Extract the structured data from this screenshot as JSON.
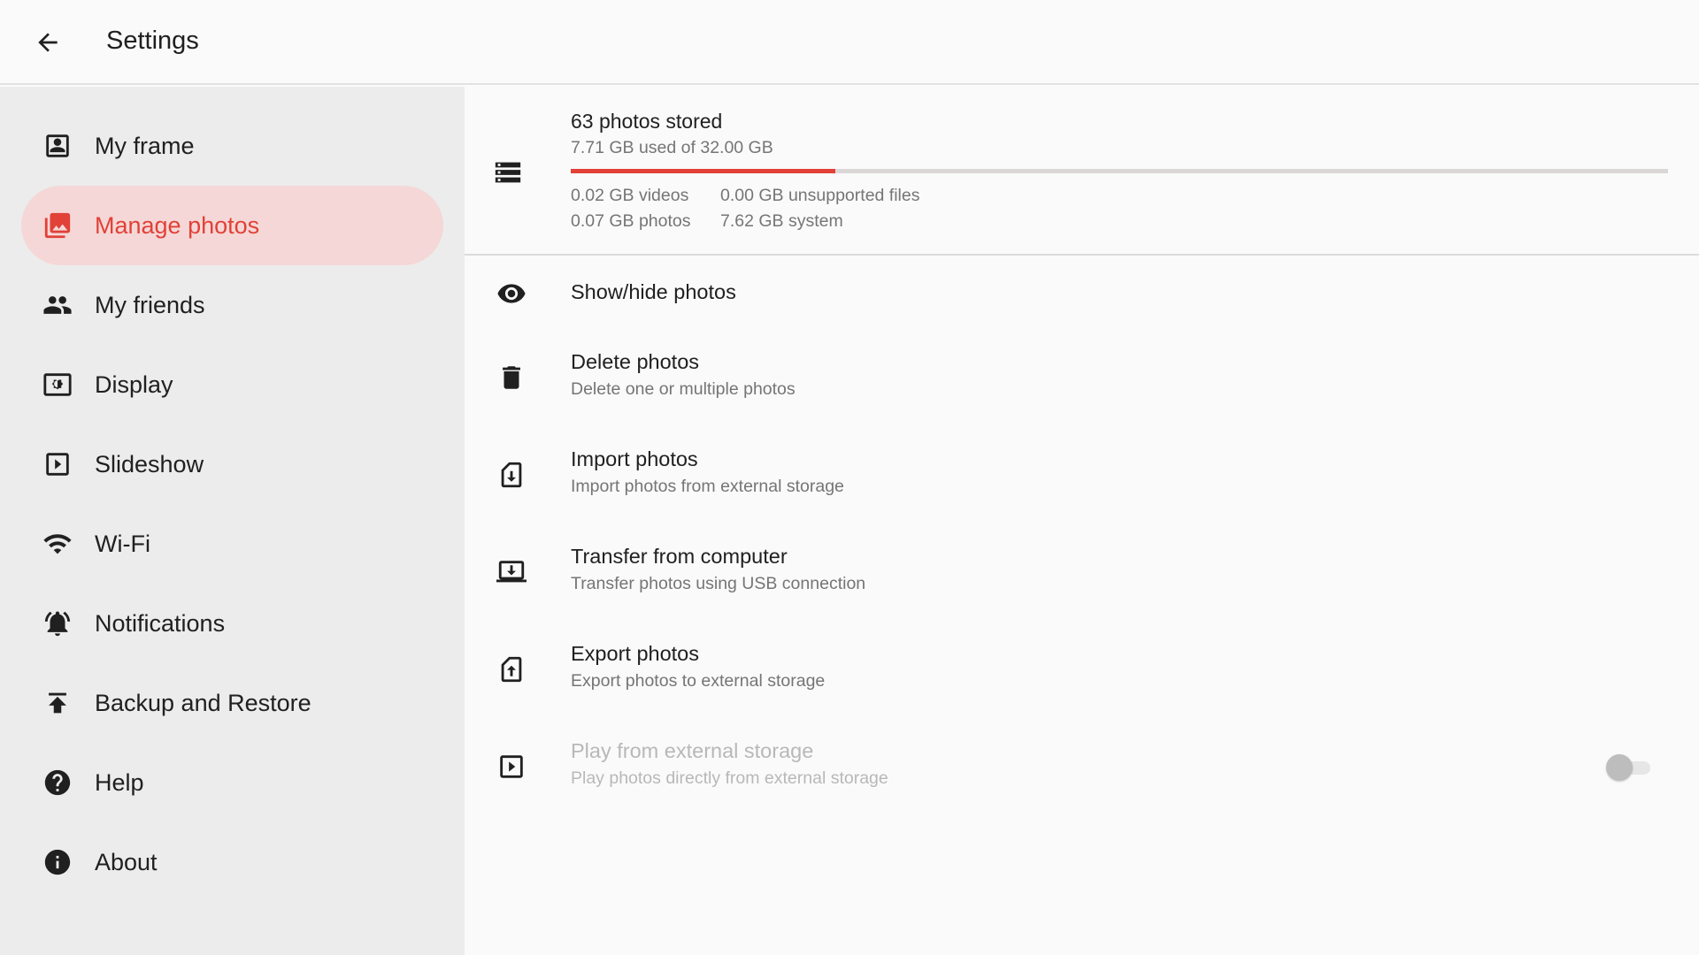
{
  "header": {
    "title": "Settings",
    "back_icon": "arrow-back-icon"
  },
  "sidebar": {
    "items": [
      {
        "label": "My frame",
        "icon": "frame-portrait-icon",
        "active": false
      },
      {
        "label": "Manage photos",
        "icon": "photo-library-icon",
        "active": true
      },
      {
        "label": "My friends",
        "icon": "people-icon",
        "active": false
      },
      {
        "label": "Display",
        "icon": "brightness-icon",
        "active": false
      },
      {
        "label": "Slideshow",
        "icon": "slideshow-icon",
        "active": false
      },
      {
        "label": "Wi-Fi",
        "icon": "wifi-icon",
        "active": false
      },
      {
        "label": "Notifications",
        "icon": "bell-icon",
        "active": false
      },
      {
        "label": "Backup and Restore",
        "icon": "upload-icon",
        "active": false
      },
      {
        "label": "Help",
        "icon": "help-icon",
        "active": false
      },
      {
        "label": "About",
        "icon": "info-icon",
        "active": false
      }
    ]
  },
  "storage": {
    "title": "63 photos stored",
    "subtitle": "7.71 GB used of 32.00 GB",
    "used_fraction": 0.241,
    "breakdown": {
      "videos": "0.02 GB videos",
      "photos": "0.07 GB photos",
      "unsupported": "0.00 GB unsupported files",
      "system": "7.62 GB system"
    }
  },
  "options": [
    {
      "title": "Show/hide photos",
      "subtitle": "",
      "icon": "eye-icon"
    },
    {
      "title": "Delete photos",
      "subtitle": "Delete one or multiple photos",
      "icon": "trash-icon"
    },
    {
      "title": "Import photos",
      "subtitle": "Import photos from external storage",
      "icon": "sd-import-icon"
    },
    {
      "title": "Transfer from computer",
      "subtitle": "Transfer photos using USB connection",
      "icon": "laptop-download-icon"
    },
    {
      "title": "Export photos",
      "subtitle": "Export photos to external storage",
      "icon": "sd-export-icon"
    },
    {
      "title": "Play from external storage",
      "subtitle": "Play photos directly from external storage",
      "icon": "play-box-icon",
      "disabled": true,
      "toggle_on": false
    }
  ],
  "colors": {
    "accent": "#e14137",
    "active_bg": "#f5d7d7",
    "sidebar_bg": "#ececec"
  }
}
